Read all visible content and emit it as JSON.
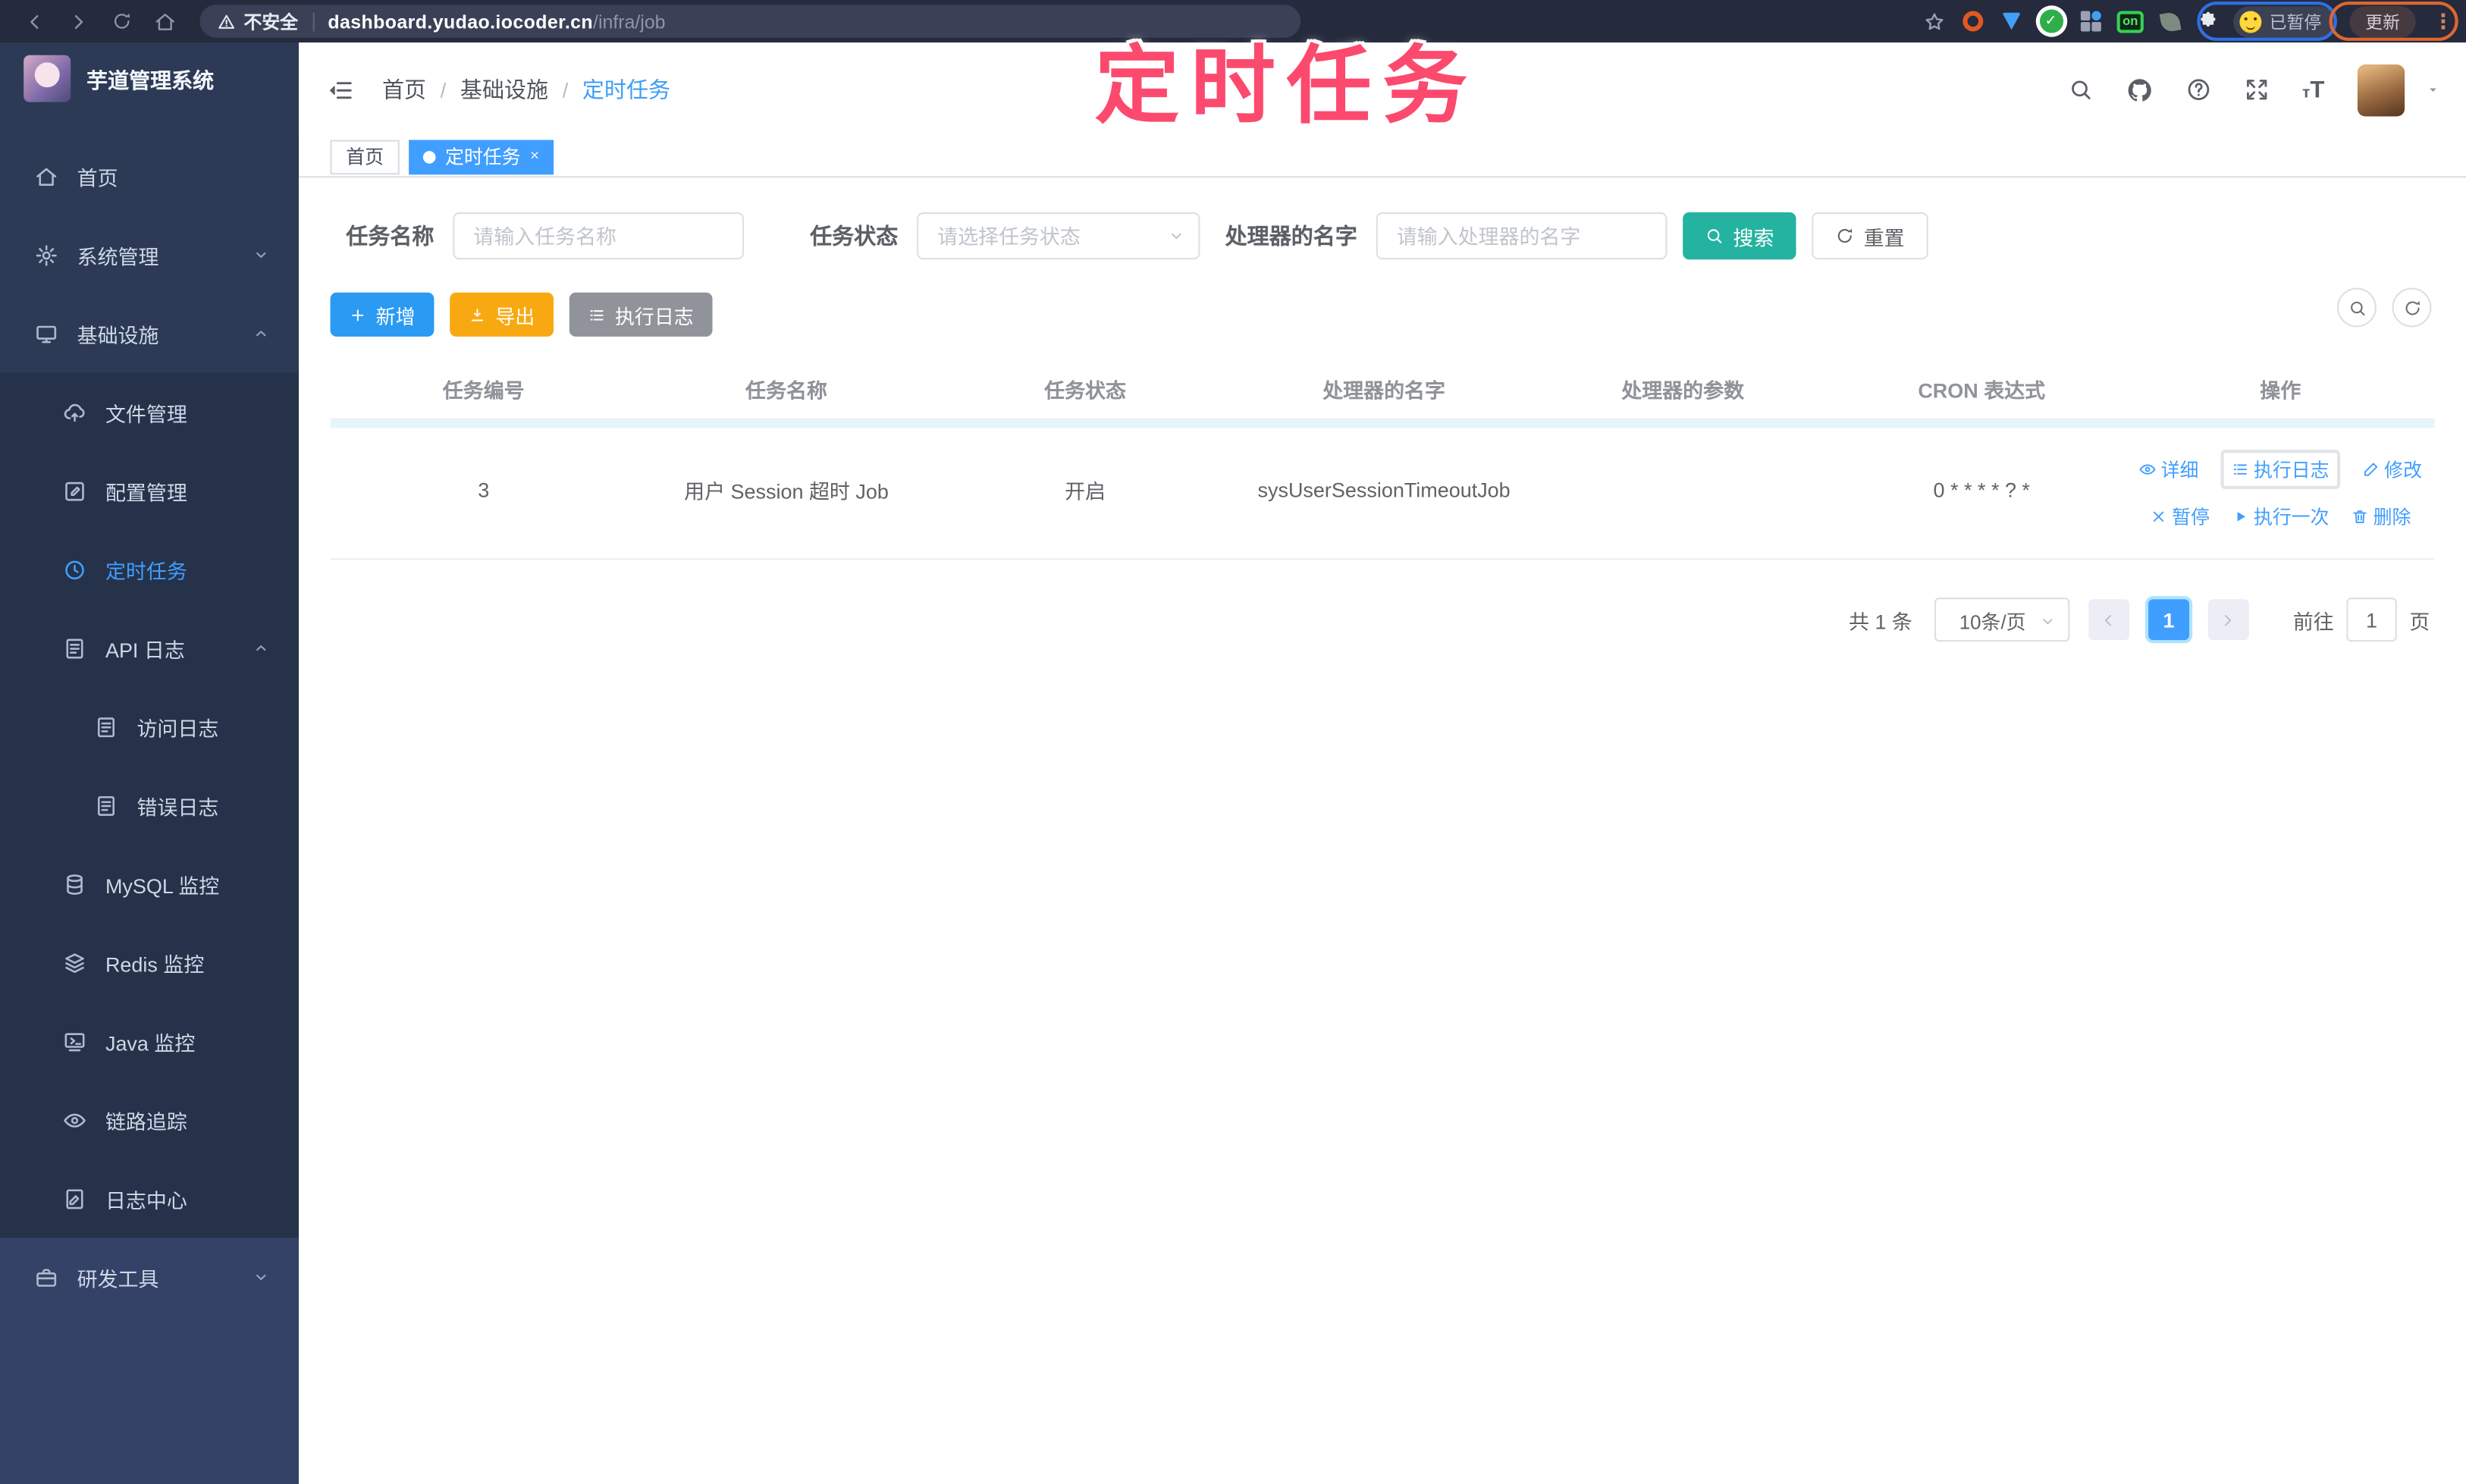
{
  "colors": {
    "accent": "#409eff",
    "search_button": "#23b3a0",
    "export_button": "#f8a912",
    "info_button": "#909399",
    "annotation_pink": "#fb4a6e",
    "sidebar_bg": "#2c3a55"
  },
  "overlay": {
    "title": "定时任务"
  },
  "browser": {
    "security_label": "不安全",
    "url_host": "dashboard.yudao.iocoder.cn",
    "url_path": "/infra/job",
    "on_badge": "on",
    "paused_badge": "已暂停",
    "update_button": "更新",
    "menu_dots": "⋮"
  },
  "sidebar": {
    "logo_title": "芋道管理系统",
    "items": [
      {
        "label": "首页",
        "icon": "home-icon"
      },
      {
        "label": "系统管理",
        "icon": "gear-icon",
        "chevron": "down"
      },
      {
        "label": "基础设施",
        "icon": "monitor-icon",
        "chevron": "up"
      },
      {
        "label": "文件管理",
        "icon": "cloud-upload-icon"
      },
      {
        "label": "配置管理",
        "icon": "edit-square-icon"
      },
      {
        "label": "定时任务",
        "icon": "clock-icon",
        "active": true
      },
      {
        "label": "API 日志",
        "icon": "log-doc-icon",
        "chevron": "up"
      },
      {
        "label": "访问日志",
        "icon": "log-doc-icon"
      },
      {
        "label": "错误日志",
        "icon": "log-doc-icon"
      },
      {
        "label": "MySQL 监控",
        "icon": "database-icon"
      },
      {
        "label": "Redis 监控",
        "icon": "stack-icon"
      },
      {
        "label": "Java 监控",
        "icon": "terminal-icon"
      },
      {
        "label": "链路追踪",
        "icon": "eye-icon"
      },
      {
        "label": "日志中心",
        "icon": "log-center-icon"
      },
      {
        "label": "研发工具",
        "icon": "briefcase-icon",
        "chevron": "down"
      }
    ]
  },
  "breadcrumb": {
    "items": [
      "首页",
      "基础设施",
      "定时任务"
    ],
    "separator": "/"
  },
  "tags": [
    {
      "label": "首页",
      "active": false
    },
    {
      "label": "定时任务",
      "active": true,
      "close": "×"
    }
  ],
  "filters": {
    "name_label": "任务名称",
    "name_placeholder": "请输入任务名称",
    "status_label": "任务状态",
    "status_placeholder": "请选择任务状态",
    "handler_label": "处理器的名字",
    "handler_placeholder": "请输入处理器的名字",
    "search_label": "搜索",
    "reset_label": "重置"
  },
  "toolbar": {
    "add_label": "新增",
    "export_label": "导出",
    "exec_log_label": "执行日志"
  },
  "table": {
    "headers": [
      "任务编号",
      "任务名称",
      "任务状态",
      "处理器的名字",
      "处理器的参数",
      "CRON 表达式",
      "操作"
    ],
    "rows": [
      {
        "id": "3",
        "name": "用户 Session 超时 Job",
        "status": "开启",
        "handler": "sysUserSessionTimeoutJob",
        "params": "",
        "cron": "0 * * * * ? *",
        "actions_row1": [
          "详细",
          "执行日志",
          "修改"
        ],
        "actions_row2": [
          "暂停",
          "执行一次",
          "删除"
        ]
      }
    ]
  },
  "pagination": {
    "total": "共 1 条",
    "page_size": "10条/页",
    "current_page": "1",
    "goto_label": "前往",
    "goto_value": "1",
    "unit_label": "页"
  }
}
